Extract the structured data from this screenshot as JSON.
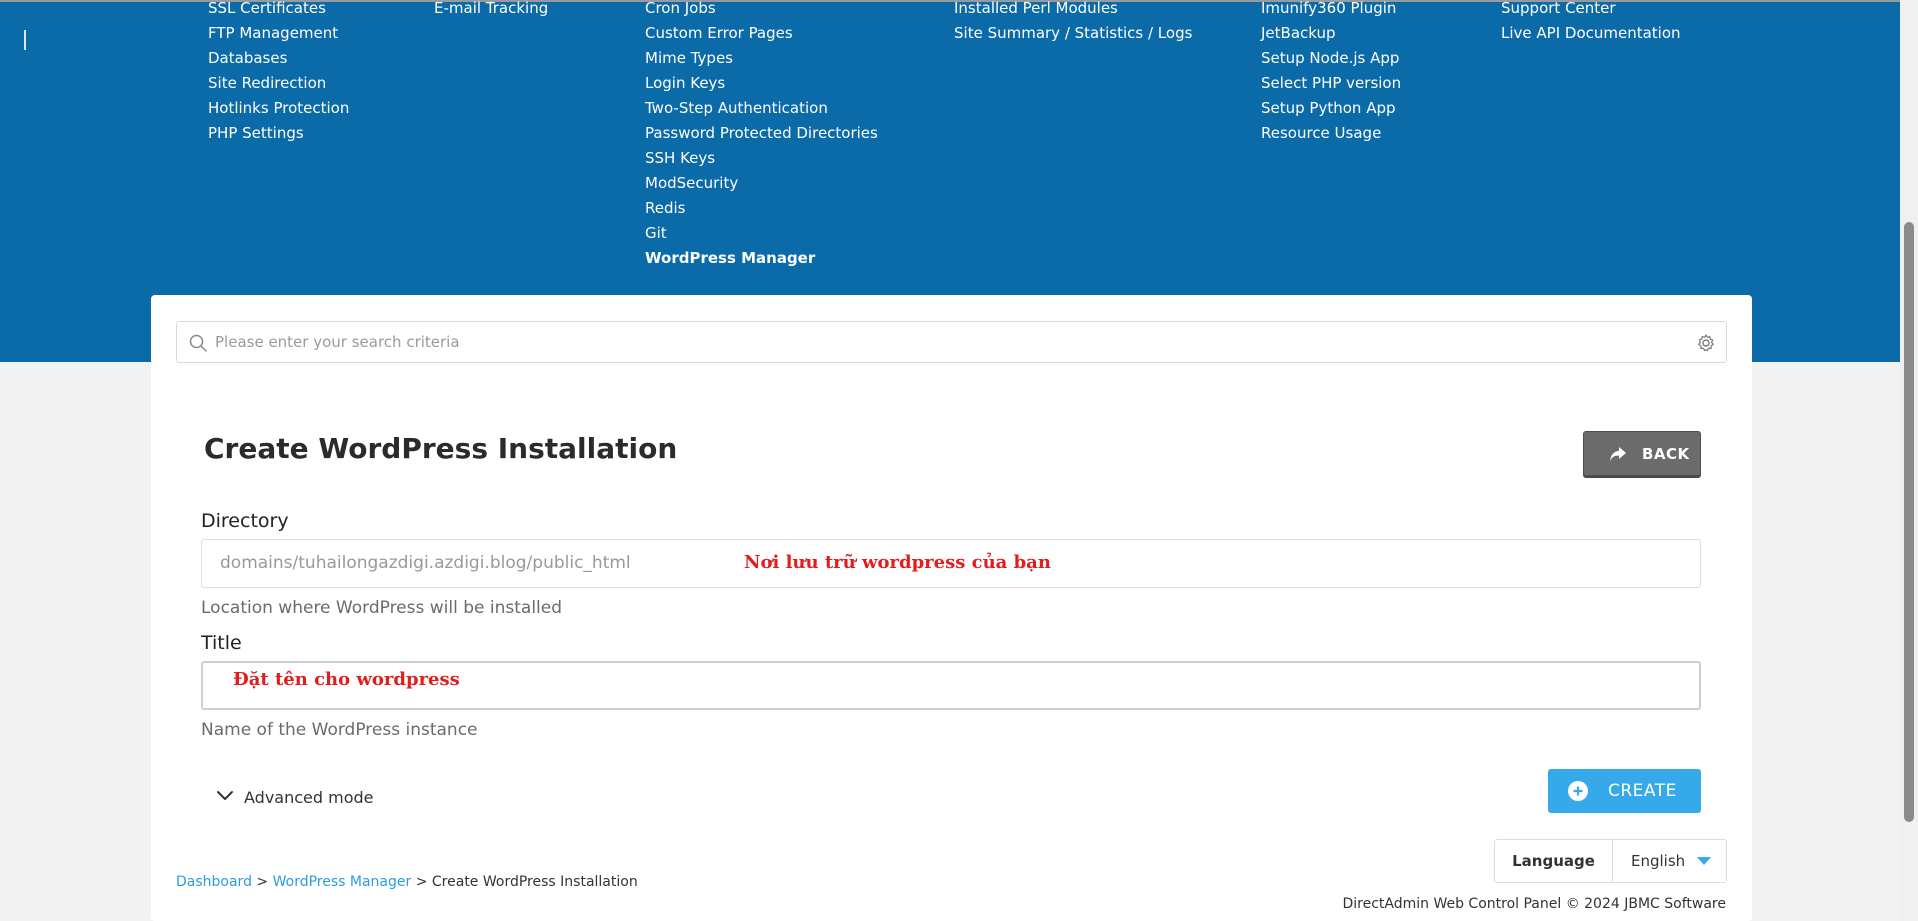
{
  "nav": {
    "col1": [
      "SSL Certificates",
      "FTP Management",
      "Databases",
      "Site Redirection",
      "Hotlinks Protection",
      "PHP Settings"
    ],
    "col2": [
      "E-mail Tracking"
    ],
    "col3": [
      "Cron Jobs",
      "Custom Error Pages",
      "Mime Types",
      "Login Keys",
      "Two-Step Authentication",
      "Password Protected Directories",
      "SSH Keys",
      "ModSecurity",
      "Redis",
      "Git",
      "WordPress Manager"
    ],
    "col4": [
      "Installed Perl Modules",
      "Site Summary / Statistics / Logs"
    ],
    "col5": [
      "Imunify360 Plugin",
      "JetBackup",
      "Setup Node.js App",
      "Select PHP version",
      "Setup Python App",
      "Resource Usage"
    ],
    "col6": [
      "Support Center",
      "Live API Documentation"
    ]
  },
  "search": {
    "placeholder": "Please enter your search criteria"
  },
  "page": {
    "title": "Create WordPress Installation",
    "back_label": "BACK"
  },
  "form": {
    "directory": {
      "label": "Directory",
      "value": "domains/tuhailongazdigi.azdigi.blog/public_html",
      "help": "Location where WordPress will be installed",
      "annotation": "Nơi lưu trữ wordpress của bạn"
    },
    "title": {
      "label": "Title",
      "value": "",
      "help": "Name of the WordPress instance",
      "annotation": "Đặt tên cho wordpress"
    },
    "advanced_label": "Advanced mode",
    "create_label": "CREATE"
  },
  "language": {
    "label": "Language",
    "selected": "English"
  },
  "breadcrumb": {
    "items": [
      "Dashboard",
      "WordPress Manager"
    ],
    "current": "Create WordPress Installation",
    "separator": ">"
  },
  "footer": {
    "text": "DirectAdmin Web Control Panel © 2024 JBMC Software"
  },
  "colors": {
    "header_bg": "#0b6aa8",
    "accent": "#36a9eb",
    "annotation": "#e11d1d",
    "back_button": "#6b6b6b"
  }
}
